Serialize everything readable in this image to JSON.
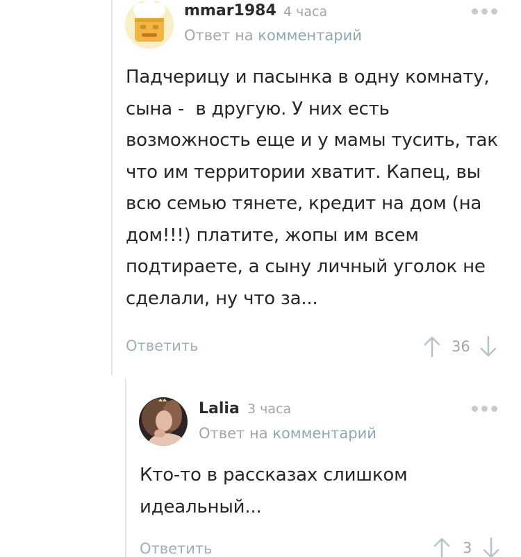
{
  "comments": [
    {
      "username": "mmar1984",
      "time": "4 часа",
      "reply_prefix": "Ответ на",
      "reply_link": "комментарий",
      "text": "Падчерицу и пасынка в одну комнату,\nсына -  в другую. У них есть\nвозможность еще и у мамы тусить, так\nчто им территории хватит. Капец, вы\nвсю семью тянете, кредит на дом (на\nдом!!!) платите, жопы им всем\nподтираете, а сыну личный уголок не\nсделали, ну что за...",
      "reply_action": "Ответить",
      "score": "36"
    },
    {
      "username": "Lalia",
      "time": "3 часа",
      "reply_prefix": "Ответ на",
      "reply_link": "комментарий",
      "text": "Кто-то в рассказах слишком\nидеальный...",
      "reply_action": "Ответить",
      "score": "3"
    }
  ],
  "icons": {
    "more": "more-dots-icon",
    "upvote": "arrow-up-icon",
    "downvote": "arrow-down-icon"
  },
  "colors": {
    "link": "#8ea8b1",
    "muted": "#9fa7ad",
    "thread_line": "#e3e6e8",
    "vote_arrow": "#b9c4ca"
  }
}
